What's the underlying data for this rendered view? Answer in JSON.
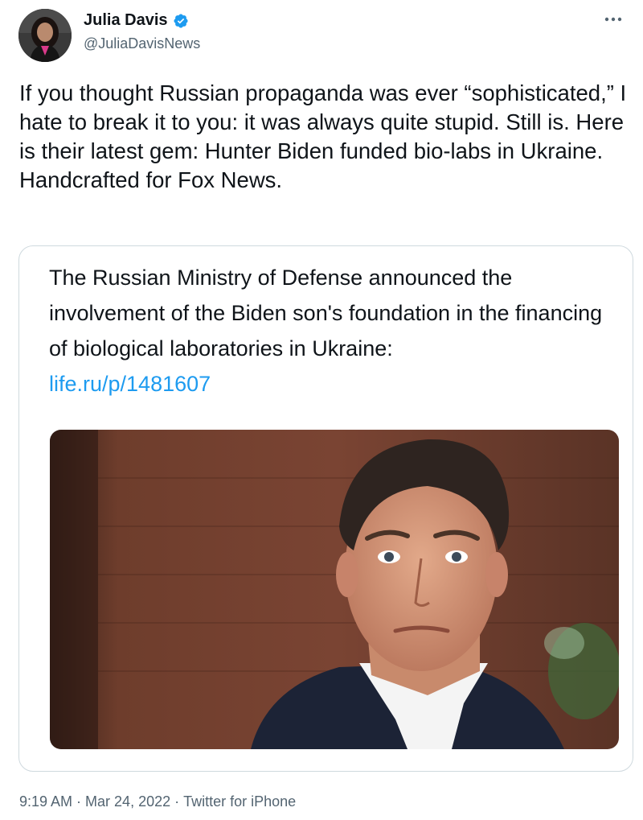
{
  "author": {
    "display_name": "Julia Davis",
    "handle": "@JuliaDavisNews",
    "verified": true,
    "avatar_icon": "profile-photo"
  },
  "tweet": {
    "text": "If you thought Russian propaganda was ever “sophisticated,” I hate to break it to you: it was always quite stupid. Still is. Here is their latest gem: Hunter Biden funded bio-labs in Ukraine. Handcrafted for Fox News."
  },
  "quote": {
    "text": "The Russian Ministry of Defense announced the involvement of the Biden son's foundation in the financing of biological laboratories in Ukraine:",
    "link": "life.ru/p/1481607",
    "image_icon": "portrait-photo"
  },
  "meta": {
    "time": "9:19 AM",
    "separator": " · ",
    "date": "Mar 24, 2022",
    "source": "Twitter for iPhone"
  },
  "colors": {
    "link": "#1d9bf0",
    "secondary_text": "#536471",
    "verified_badge": "#1d9bf0",
    "border": "#cfd9de"
  }
}
